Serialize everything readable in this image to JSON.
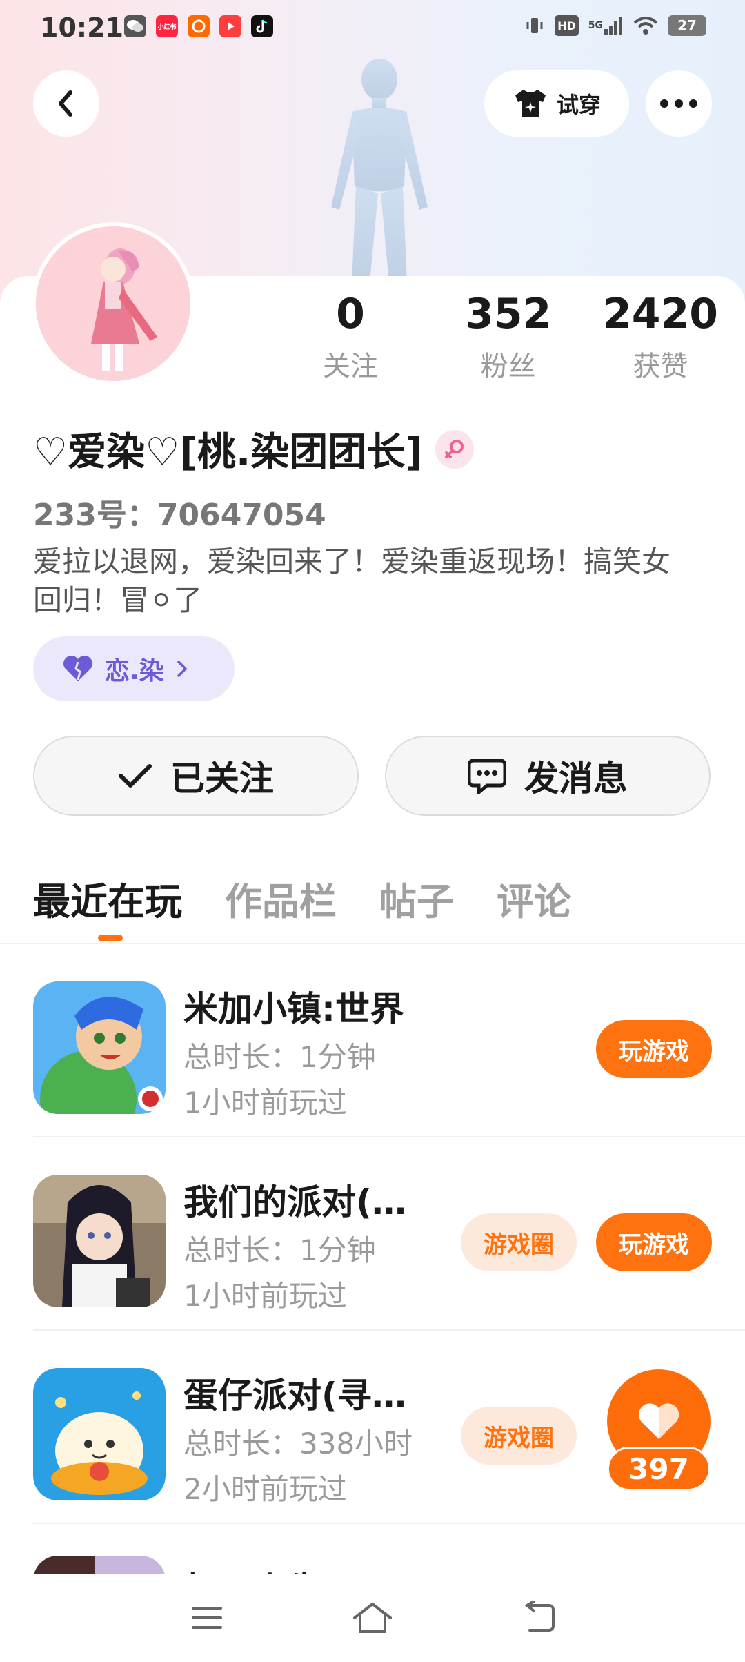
{
  "status_bar": {
    "time": "10:21",
    "apps": [
      {
        "name": "wechat-icon",
        "glyph": "",
        "color": "#ffffff"
      },
      {
        "name": "xiaohongshu-icon",
        "glyph": "小红书",
        "color": "#ff2442"
      },
      {
        "name": "taobao-icon",
        "glyph": "",
        "color": "#ff6a00"
      },
      {
        "name": "video-app-icon",
        "glyph": "",
        "color": "#ff3d3d"
      },
      {
        "name": "tiktok-icon",
        "glyph": "",
        "color": "#111111"
      }
    ],
    "network": "5G",
    "hd": "HD",
    "battery": "27"
  },
  "header": {
    "try_on_label": "试穿"
  },
  "profile": {
    "name": "♡爱染♡[桃.染团团长]",
    "uid": "233号：70647054",
    "bio": "爱拉以退网，爱染回来了！爱染重返现场！搞笑女回归！冒⚪了",
    "tag_label": "恋.染",
    "stats": [
      {
        "value": "0",
        "label": "关注"
      },
      {
        "value": "352",
        "label": "粉丝"
      },
      {
        "value": "2420",
        "label": "获赞"
      }
    ]
  },
  "actions": {
    "follow_label": "已关注",
    "message_label": "发消息"
  },
  "tabs": [
    "最近在玩",
    "作品栏",
    "帖子",
    "评论"
  ],
  "games": [
    {
      "title": "米加小镇:世界",
      "duration": "总时长：1分钟",
      "last_played": "1小时前玩过",
      "circle_label": "",
      "play_label": "玩游戏"
    },
    {
      "title": "我们的派对(…",
      "duration": "总时长：1分钟",
      "last_played": "1小时前玩过",
      "circle_label": "游戏圈",
      "play_label": "玩游戏"
    },
    {
      "title": "蛋仔派对(寻…",
      "duration": "总时长：338小时",
      "last_played": "2小时前玩过",
      "circle_label": "游戏圈",
      "play_label": ""
    },
    {
      "title": "超蛋人生",
      "duration": "",
      "last_played": "",
      "circle_label": "",
      "play_label": ""
    }
  ],
  "like_fab": {
    "count": "397"
  },
  "colors": {
    "accent": "#ff7210",
    "tag_bg": "#ece8fc",
    "tag_text": "#6b5bd6"
  }
}
